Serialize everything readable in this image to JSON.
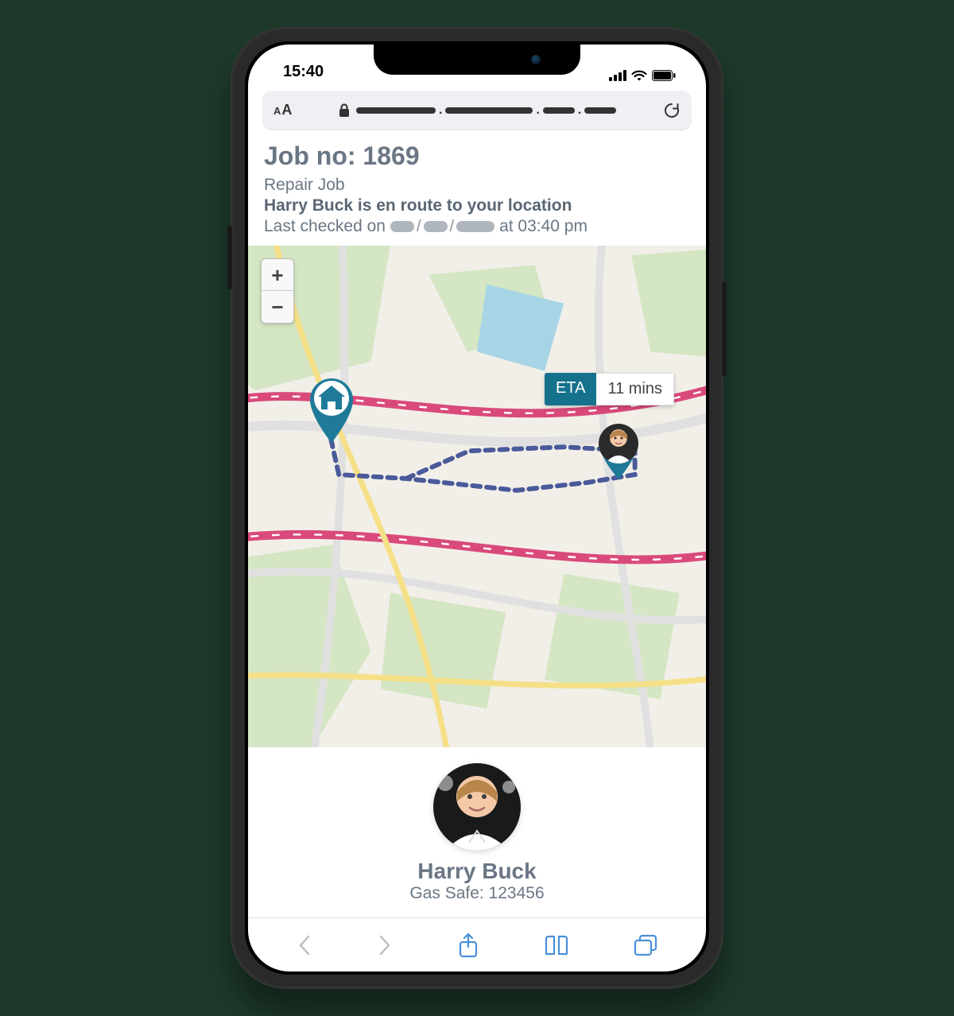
{
  "status_bar": {
    "time": "15:40"
  },
  "browser": {
    "text_size_small": "A",
    "text_size_large": "A"
  },
  "job": {
    "title": "Job no: 1869",
    "type": "Repair Job",
    "status": "Harry Buck is en route to your location",
    "checked_prefix": "Last checked on",
    "checked_time": "at 03:40 pm"
  },
  "map": {
    "eta_label": "ETA",
    "eta_value": "11 mins",
    "zoom_in": "+",
    "zoom_out": "−"
  },
  "engineer": {
    "name": "Harry Buck",
    "credential": "Gas Safe: 123456"
  }
}
